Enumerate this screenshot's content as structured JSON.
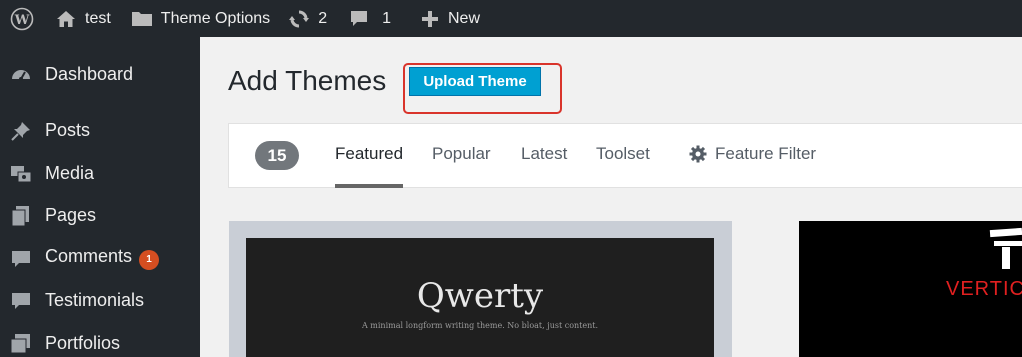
{
  "adminbar": {
    "site_name": "test",
    "theme_options": "Theme Options",
    "updates_count": "2",
    "comments_count": "1",
    "new_label": "New"
  },
  "sidebar": {
    "items": [
      {
        "label": "Dashboard",
        "icon": "dashboard-icon"
      },
      {
        "label": "Posts",
        "icon": "pin-icon"
      },
      {
        "label": "Media",
        "icon": "media-icon"
      },
      {
        "label": "Pages",
        "icon": "pages-icon"
      },
      {
        "label": "Comments",
        "icon": "comment-icon",
        "badge": "1"
      },
      {
        "label": "Testimonials",
        "icon": "comment-icon"
      },
      {
        "label": "Portfolios",
        "icon": "portfolio-icon"
      }
    ]
  },
  "main": {
    "title": "Add Themes",
    "upload_button": "Upload Theme",
    "theme_count": "15",
    "tabs": [
      {
        "label": "Featured",
        "active": true
      },
      {
        "label": "Popular",
        "active": false
      },
      {
        "label": "Latest",
        "active": false
      },
      {
        "label": "Toolset",
        "active": false
      }
    ],
    "feature_filter": "Feature Filter"
  },
  "themes": [
    {
      "title": "Qwerty",
      "tagline": "A minimal longform writing theme. No bloat, just content."
    },
    {
      "preview_text": "VERTIC"
    }
  ],
  "colors": {
    "adminbar": "#23282d",
    "accent": "#00a0d2",
    "badge": "#d54e21",
    "highlight": "#d9342b"
  }
}
